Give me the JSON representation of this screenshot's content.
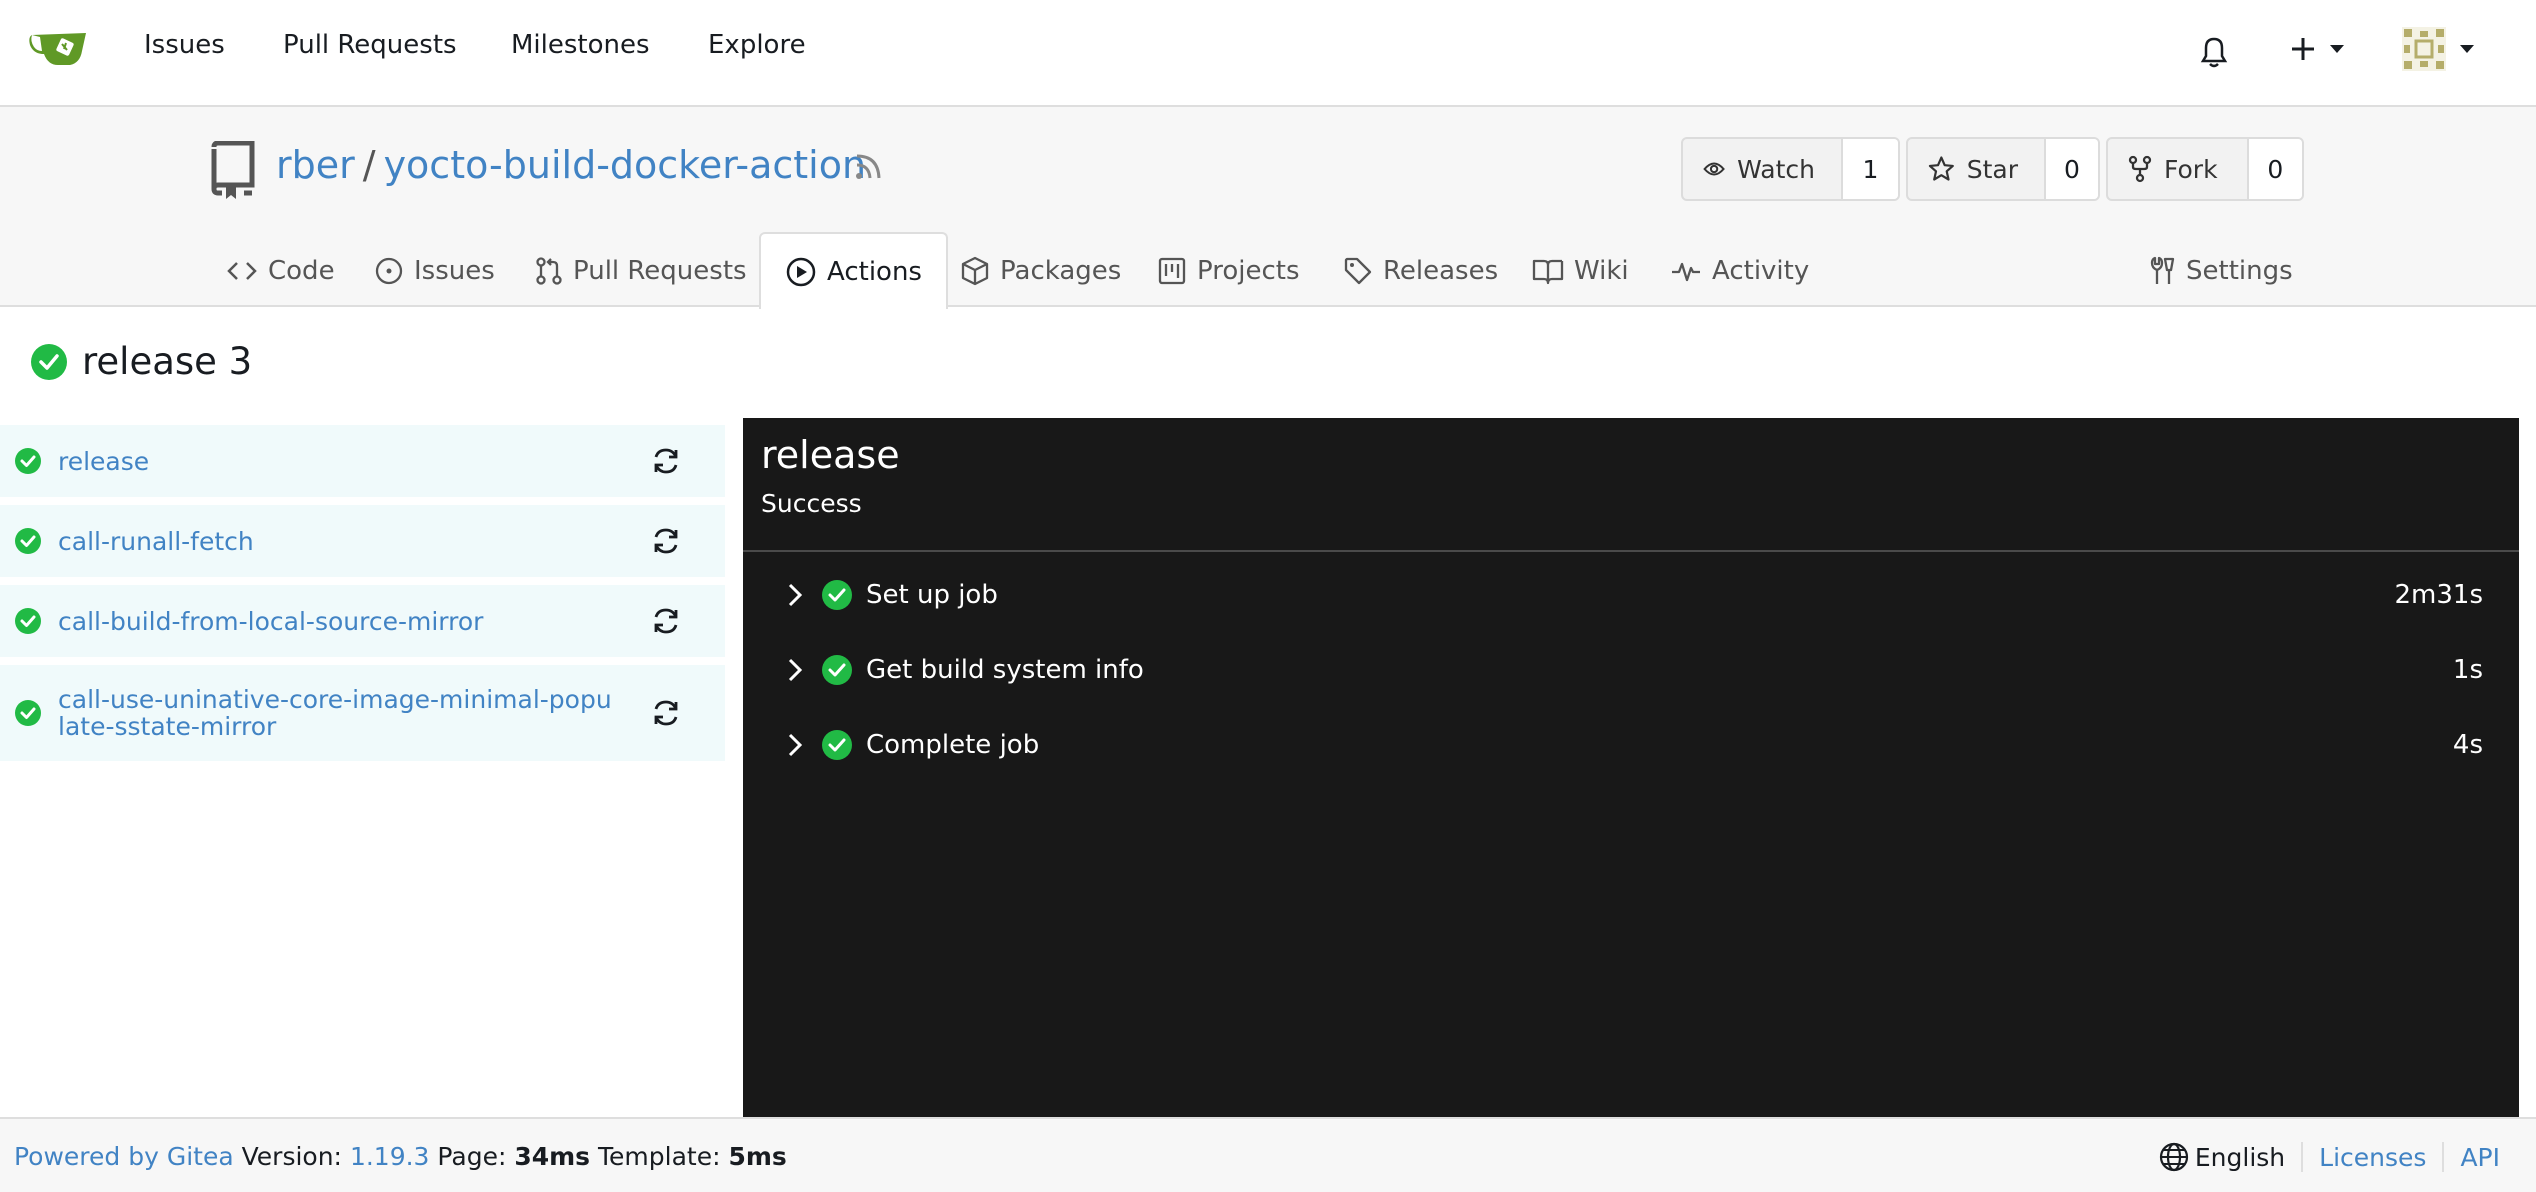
{
  "nav": {
    "items": [
      "Issues",
      "Pull Requests",
      "Milestones",
      "Explore"
    ]
  },
  "repo": {
    "owner": "rber",
    "separator": "/",
    "name": "yocto-build-docker-action",
    "watch_label": "Watch",
    "watch_count": "1",
    "star_label": "Star",
    "star_count": "0",
    "fork_label": "Fork",
    "fork_count": "0"
  },
  "tabs": {
    "code": "Code",
    "issues": "Issues",
    "pulls": "Pull Requests",
    "actions": "Actions",
    "packages": "Packages",
    "projects": "Projects",
    "releases": "Releases",
    "wiki": "Wiki",
    "activity": "Activity",
    "settings": "Settings"
  },
  "run": {
    "title": "release 3"
  },
  "jobs": [
    {
      "name": "release"
    },
    {
      "name": "call-runall-fetch"
    },
    {
      "name": "call-build-from-local-source-mirror"
    },
    {
      "name": "call-use-uninative-core-image-minimal-populate-sstate-mirror"
    }
  ],
  "log": {
    "title": "release",
    "status": "Success",
    "steps": [
      {
        "name": "Set up job",
        "duration": "2m31s"
      },
      {
        "name": "Get build system info",
        "duration": "1s"
      },
      {
        "name": "Complete job",
        "duration": "4s"
      }
    ]
  },
  "footer": {
    "powered": "Powered by Gitea",
    "version_label": "Version:",
    "version": "1.19.3",
    "page_label": "Page:",
    "page_time": "34ms",
    "template_label": "Template:",
    "template_time": "5ms",
    "language": "English",
    "licenses": "Licenses",
    "api": "API"
  },
  "colors": {
    "success": "#21ba45",
    "link": "#4183c4",
    "log_bg": "#181818"
  },
  "icons": {
    "logo": "gitea-teacup-logo",
    "bell": "bell-icon",
    "plus": "plus-icon",
    "avatar": "avatar",
    "check": "check-circle-icon",
    "rerun": "sync-icon",
    "chevron": "chevron-right-icon"
  }
}
